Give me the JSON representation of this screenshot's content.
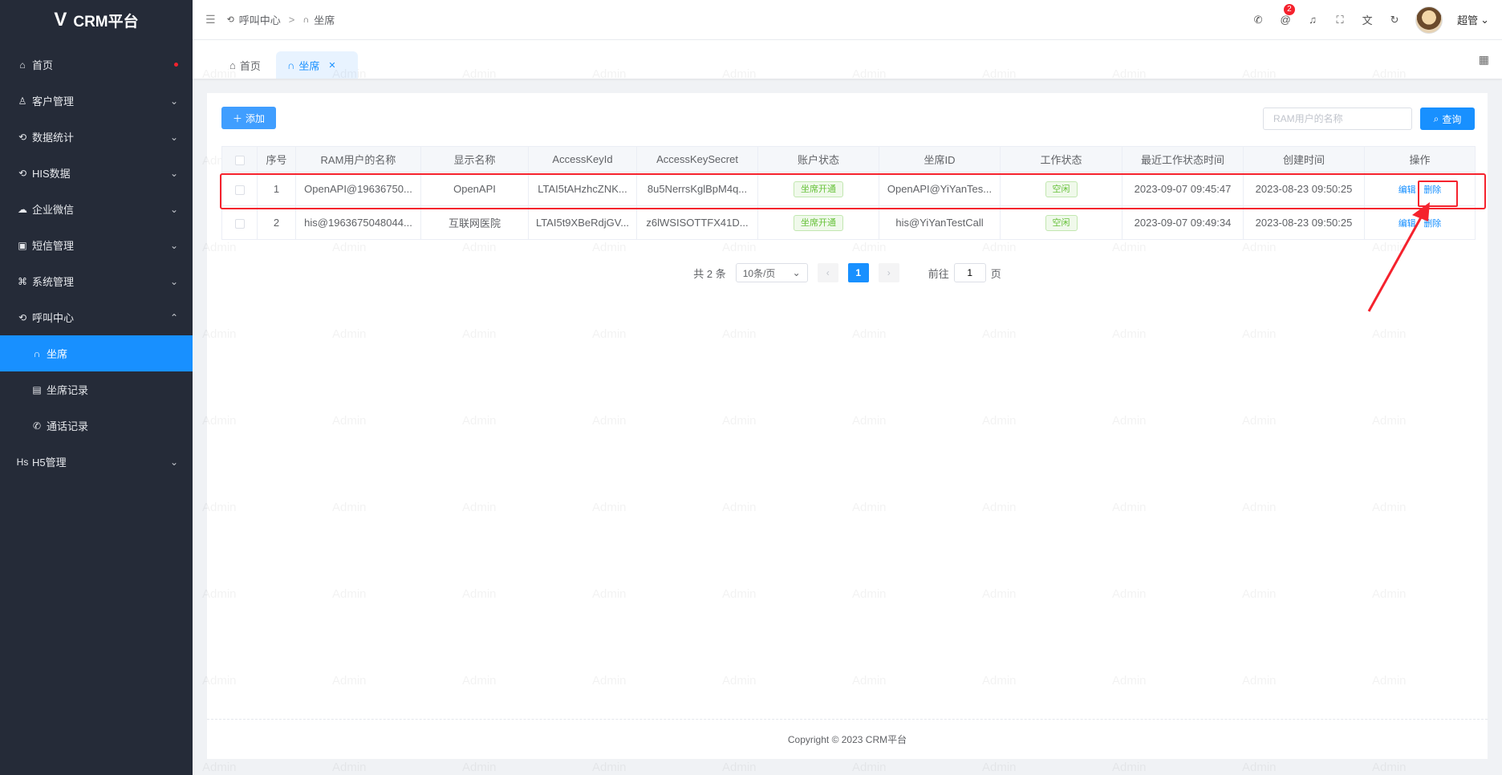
{
  "app": {
    "title": "CRM平台"
  },
  "sidebar": {
    "items": [
      {
        "label": "首页",
        "icon": "home-icon",
        "glyph": "⌂"
      },
      {
        "label": "客户管理",
        "icon": "user-icon",
        "glyph": "♙"
      },
      {
        "label": "数据统计",
        "icon": "sync-icon",
        "glyph": "⟲"
      },
      {
        "label": "HIS数据",
        "icon": "sync-icon",
        "glyph": "⟲"
      },
      {
        "label": "企业微信",
        "icon": "wechat-icon",
        "glyph": "☁"
      },
      {
        "label": "短信管理",
        "icon": "message-icon",
        "glyph": "▣"
      },
      {
        "label": "系统管理",
        "icon": "command-icon",
        "glyph": "⌘"
      },
      {
        "label": "呼叫中心",
        "icon": "call-center-icon",
        "glyph": "⟲"
      },
      {
        "label": "坐席",
        "icon": "headset-icon",
        "glyph": "∩"
      },
      {
        "label": "坐席记录",
        "icon": "clipboard-icon",
        "glyph": "▤"
      },
      {
        "label": "通话记录",
        "icon": "phone-icon",
        "glyph": "✆"
      },
      {
        "label": "H5管理",
        "icon": "h5-icon",
        "glyph": "Hs"
      }
    ]
  },
  "header": {
    "breadcrumb": [
      "呼叫中心",
      "坐席"
    ],
    "separator": ">",
    "notification_count": "2",
    "user_name": "超管"
  },
  "tabs": [
    {
      "label": "首页"
    },
    {
      "label": "坐席"
    }
  ],
  "toolbar": {
    "add_label": "添加",
    "search_placeholder": "RAM用户的名称",
    "query_label": "查询"
  },
  "watermark": "Admin",
  "table": {
    "columns": [
      "序号",
      "RAM用户的名称",
      "显示名称",
      "AccessKeyId",
      "AccessKeySecret",
      "账户状态",
      "坐席ID",
      "工作状态",
      "最近工作状态时间",
      "创建时间",
      "操作"
    ],
    "rows": [
      {
        "index": "1",
        "ram_user": "OpenAPI@19636750...",
        "display_name": "OpenAPI",
        "access_key_id": "LTAI5tAHzhcZNK...",
        "access_key_secret": "8u5NerrsKglBpM4q...",
        "account_status": "坐席开通",
        "seat_id": "OpenAPI@YiYanTes...",
        "work_status": "空闲",
        "last_status_time": "2023-09-07 09:45:47",
        "created_at": "2023-08-23 09:50:25"
      },
      {
        "index": "2",
        "ram_user": "his@1963675048044...",
        "display_name": "互联网医院",
        "access_key_id": "LTAI5t9XBeRdjGV...",
        "access_key_secret": "z6lWSISOTTFX41D...",
        "account_status": "坐席开通",
        "seat_id": "his@YiYanTestCall",
        "work_status": "空闲",
        "last_status_time": "2023-09-07 09:49:34",
        "created_at": "2023-08-23 09:50:25"
      }
    ],
    "actions": {
      "edit": "编辑",
      "delete": "删除"
    }
  },
  "pagination": {
    "total_text": "共 2 条",
    "page_size": "10条/页",
    "current_page": "1",
    "goto_prefix": "前往",
    "goto_value": "1",
    "goto_suffix": "页"
  },
  "footer": {
    "copyright": "Copyright © 2023 CRM平台"
  },
  "colors": {
    "sidebar_bg": "#252b38",
    "primary": "#1890ff",
    "highlight": "#f5222d"
  }
}
